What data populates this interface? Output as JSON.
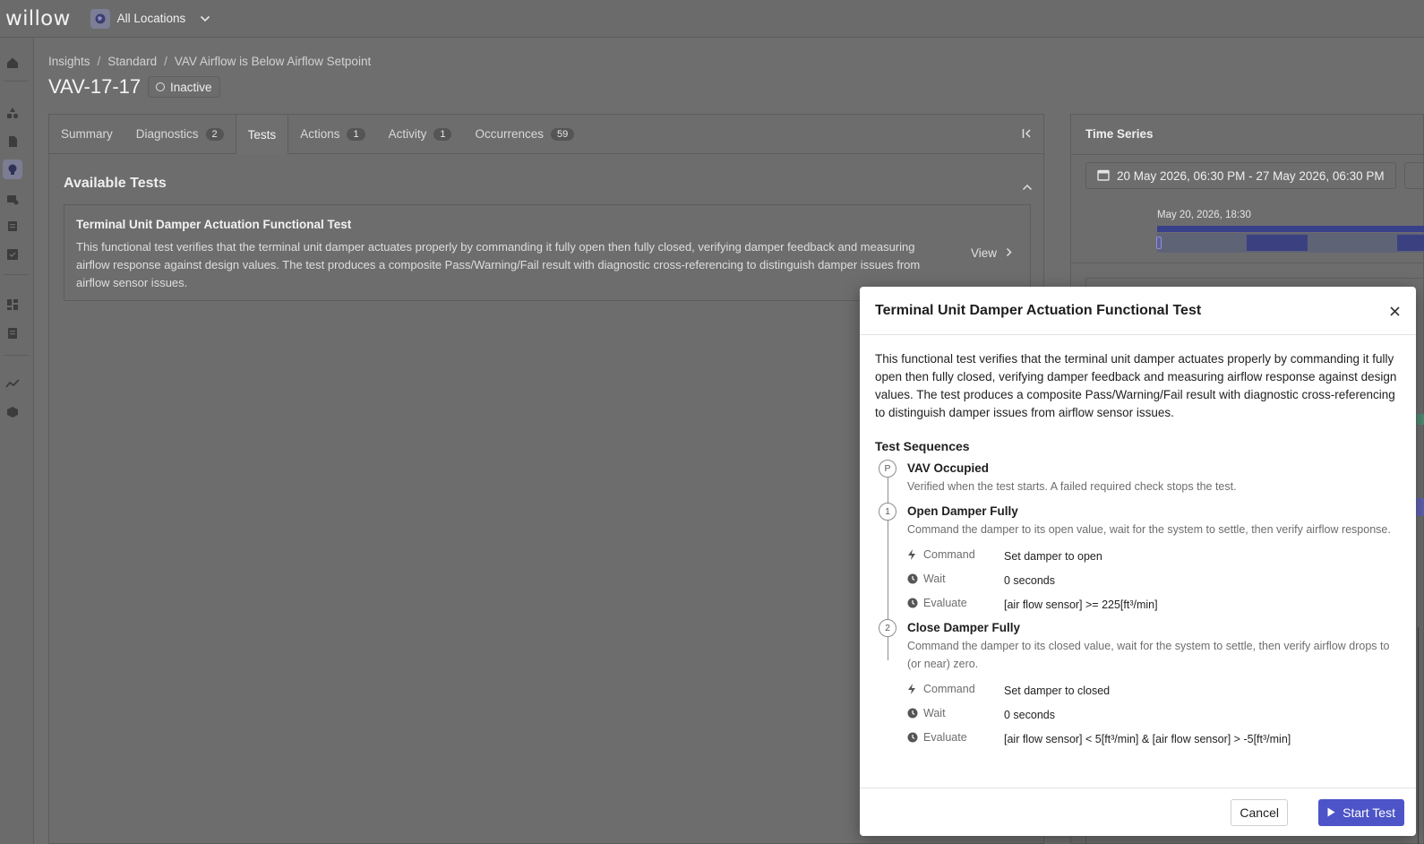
{
  "app": {
    "logo": "willow",
    "location": "All Locations"
  },
  "breadcrumb": [
    "Insights",
    "Standard",
    "VAV Airflow is Below Airflow Setpoint"
  ],
  "page": {
    "title": "VAV-17-17",
    "status": "Inactive"
  },
  "tabs": [
    {
      "label": "Summary",
      "count": ""
    },
    {
      "label": "Diagnostics",
      "count": "2"
    },
    {
      "label": "Tests",
      "count": "",
      "active": true
    },
    {
      "label": "Actions",
      "count": "1"
    },
    {
      "label": "Activity",
      "count": "1"
    },
    {
      "label": "Occurrences",
      "count": "59"
    }
  ],
  "tests": {
    "section_title": "Available Tests",
    "card": {
      "title": "Terminal Unit Damper Actuation Functional Test",
      "description": "This functional test verifies that the terminal unit damper actuates properly by commanding it fully open then fully closed, verifying damper feedback and measuring airflow response against design values. The test produces a composite Pass/Warning/Fail result with diagnostic cross-referencing to distinguish damper issues from airflow sensor issues.",
      "view_label": "View"
    }
  },
  "time_series": {
    "title": "Time Series",
    "date_range": "20 May 2026, 06:30 PM - 27 May 2026, 06:30 PM",
    "timeline_label": "May 20, 2026, 18:30"
  },
  "modal": {
    "title": "Terminal Unit Damper Actuation Functional Test",
    "description": "This functional test verifies that the terminal unit damper actuates properly by commanding it fully open then fully closed, verifying damper feedback and measuring airflow response against design values. The test produces a composite Pass/Warning/Fail result with diagnostic cross-referencing to distinguish damper issues from airflow sensor issues.",
    "sequences_title": "Test Sequences",
    "steps": [
      {
        "marker": "P",
        "name": "VAV Occupied",
        "description": "Verified when the test starts. A failed required check stops the test."
      },
      {
        "marker": "1",
        "name": "Open Damper Fully",
        "description": "Command the damper to its open value, wait for the system to settle, then verify airflow response.",
        "command_label": "Command",
        "command": "Set damper to open",
        "wait_label": "Wait",
        "wait": "0 seconds",
        "evaluate_label": "Evaluate",
        "evaluate": "[air flow sensor] >= 225[ft³/min]"
      },
      {
        "marker": "2",
        "name": "Close Damper Fully",
        "description": "Command the damper to its closed value, wait for the system to settle, then verify airflow drops to (or near) zero.",
        "command_label": "Command",
        "command": "Set damper to closed",
        "wait_label": "Wait",
        "wait": "0 seconds",
        "evaluate_label": "Evaluate",
        "evaluate": "[air flow sensor] < 5[ft³/min] & [air flow sensor] > -5[ft³/min]"
      }
    ],
    "cancel_label": "Cancel",
    "start_label": "Start Test"
  },
  "colors": {
    "primary": "#4c54c7",
    "overlay": "#6d6d6d"
  }
}
